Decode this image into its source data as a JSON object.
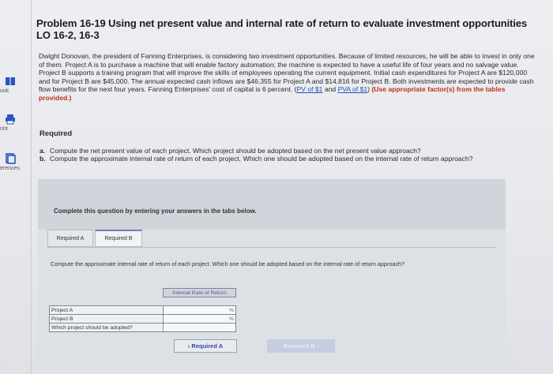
{
  "sidebar": {
    "items": [
      {
        "label": "ook",
        "icon": "book-icon"
      },
      {
        "label": "rint",
        "icon": "print-icon"
      },
      {
        "label": "erences",
        "icon": "references-icon"
      }
    ]
  },
  "problem": {
    "title_line1": "Problem 16-19 Using net present value and internal rate of return to evaluate investment opportunities",
    "title_line2": "LO 16-2, 16-3",
    "intro": "Dwight Donovan, the president of Fanning Enterprises, is considering two investment opportunities. Because of limited resources, he will be able to invest in only one of them. Project A is to purchase a machine that will enable factory automation; the machine is expected to have a useful life of four years and no salvage value. Project B supports a training program that will improve the skills of employees operating the current equipment. Initial cash expenditures for Project A are $120,000 and for Project B are $45,000. The annual expected cash inflows are $46,355 for Project A and $14,816 for Project B. Both investments are expected to provide cash flow benefits for the next four years. Fanning Enterprises' cost of capital is 6 percent.",
    "link_pv": "PV of $1",
    "link_and": "and",
    "link_pva": "PVA of $1",
    "factor_note": "(Use appropriate factor(s) from the tables provided.)",
    "required_heading": "Required",
    "questions": [
      {
        "letter": "a.",
        "text": "Compute the net present value of each project. Which project should be adopted based on the net present value approach?"
      },
      {
        "letter": "b.",
        "text": "Compute the approximate internal rate of return of each project. Which one should be adopted based on the internal rate of return approach?"
      }
    ]
  },
  "panel": {
    "instruction": "Complete this question by entering your answers in the tabs below.",
    "tabs": [
      {
        "label": "Required A"
      },
      {
        "label": "Required B"
      }
    ],
    "compute_text": "Compute the approximate internal rate of return of each project. Which one should be adopted based on the internal rate of return approach?",
    "table": {
      "header": "Internal Rate of Return",
      "rows": [
        {
          "label": "Project A",
          "value": "%"
        },
        {
          "label": "Project B",
          "value": "%"
        },
        {
          "label": "Which project should be adopted?",
          "value": ""
        }
      ]
    },
    "prev_button": "Required A",
    "next_button": "Required B"
  }
}
